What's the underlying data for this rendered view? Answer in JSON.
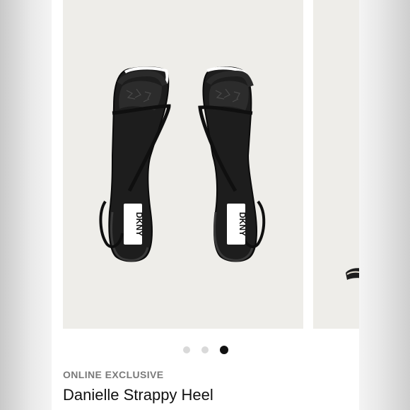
{
  "product": {
    "badge": "ONLINE EXCLUSIVE",
    "name": "Danielle Strappy Heel",
    "insole_logo": "DKNY",
    "image": {
      "subject": "pair of black strappy heeled sandals, top view",
      "background_color": "#eeede9"
    }
  },
  "carousel": {
    "slide_count": 3,
    "active_index": 2
  },
  "colors": {
    "active_dot": "#111111",
    "inactive_dot": "#d9d9d9",
    "badge_text": "#7a7a7a",
    "title_text": "#111111"
  }
}
